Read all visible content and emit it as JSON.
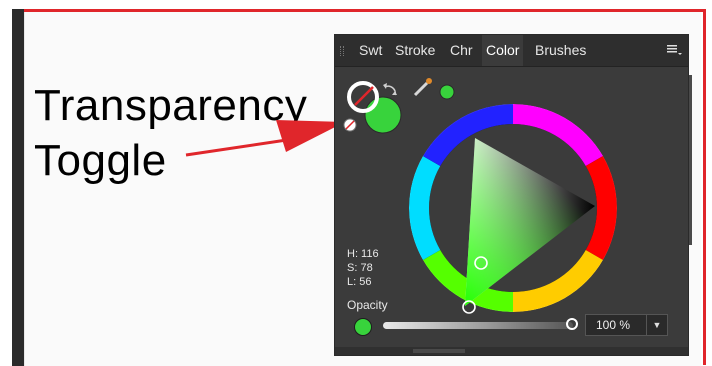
{
  "annotation": {
    "line1": "Transparency",
    "line2": "Toggle",
    "arrow_color": "#e0262b"
  },
  "panel": {
    "tabs": [
      {
        "label": "Swt",
        "active": false
      },
      {
        "label": "Stroke",
        "active": false
      },
      {
        "label": "Chr",
        "active": false
      },
      {
        "label": "Color",
        "active": true
      },
      {
        "label": "Brushes",
        "active": false
      }
    ],
    "menu_icon": "hamburger-menu-icon",
    "fill_color": "#38d33c",
    "hsl": {
      "h": "H: 116",
      "s": "S: 78",
      "l": "L: 56"
    },
    "opacity": {
      "label": "Opacity",
      "value": "100 %",
      "level": 1.0
    }
  },
  "colors": {
    "frame_border": "#e0262b",
    "panel_bg": "#3b3b3b",
    "tab_bg": "#2e2e2e"
  }
}
